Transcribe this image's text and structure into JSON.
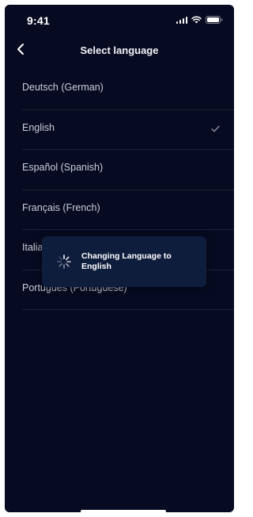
{
  "status_bar": {
    "time": "9:41"
  },
  "header": {
    "title": "Select language"
  },
  "languages": [
    {
      "label": "Deutsch (German)",
      "selected": false
    },
    {
      "label": "English",
      "selected": true
    },
    {
      "label": "Español (Spanish)",
      "selected": false
    },
    {
      "label": "Français (French)",
      "selected": false
    },
    {
      "label": "Italiano (Italian)",
      "selected": false
    },
    {
      "label": "Português (Portuguese)",
      "selected": false
    }
  ],
  "toast": {
    "message": "Changing Language to English"
  },
  "icons": {
    "back": "chevron-left-icon",
    "check": "checkmark-icon",
    "spinner": "loading-spinner-icon"
  },
  "colors": {
    "background": "#070b21",
    "toast": "#0f1d3d",
    "divider": "#1c2236"
  }
}
